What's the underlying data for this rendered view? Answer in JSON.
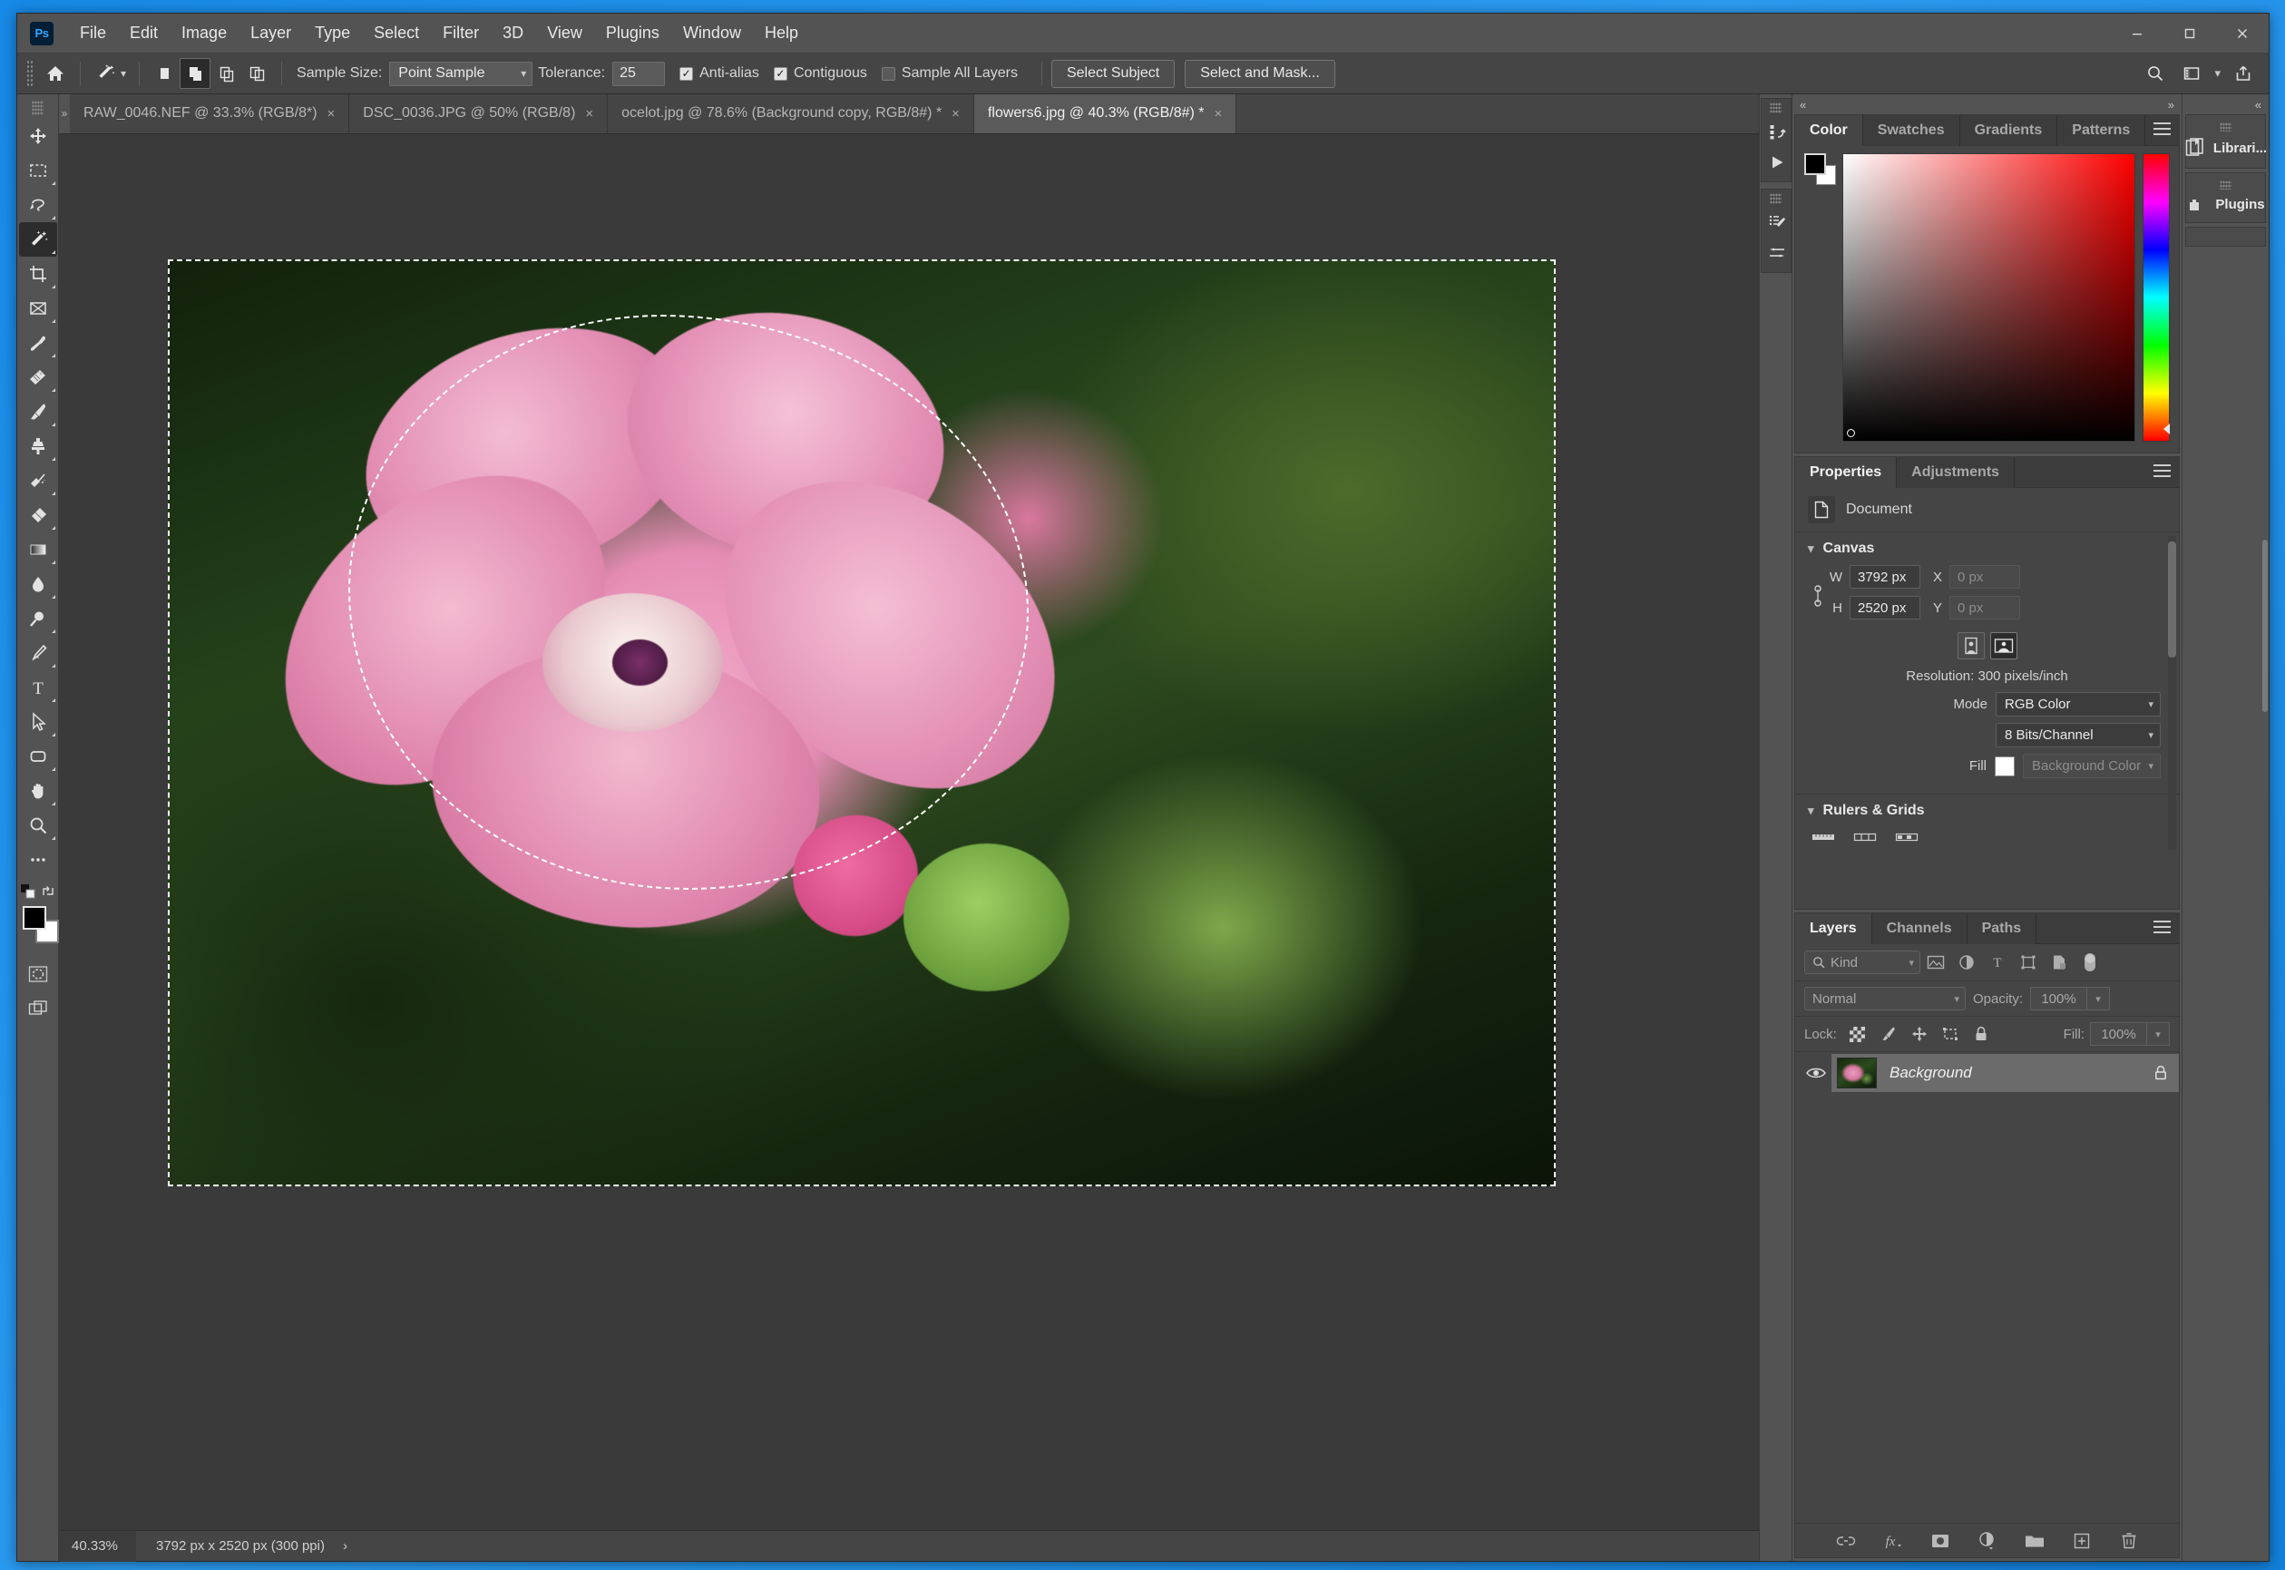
{
  "app": {
    "logo": "Ps",
    "menu": [
      "File",
      "Edit",
      "Image",
      "Layer",
      "Type",
      "Select",
      "Filter",
      "3D",
      "View",
      "Plugins",
      "Window",
      "Help"
    ],
    "window_controls": [
      "minimize-button",
      "maximize-button",
      "close-button"
    ]
  },
  "options_bar": {
    "home_icon": "home-icon",
    "tool_icon": "magic-wand-icon",
    "selection_modes": [
      "new-selection",
      "add-to-selection",
      "subtract-from-selection",
      "intersect-with-selection"
    ],
    "active_selection_mode": 1,
    "sample_size_label": "Sample Size:",
    "sample_size_value": "Point Sample",
    "tolerance_label": "Tolerance:",
    "tolerance_value": "25",
    "anti_alias_label": "Anti-alias",
    "anti_alias_checked": true,
    "contiguous_label": "Contiguous",
    "contiguous_checked": true,
    "sample_all_layers_label": "Sample All Layers",
    "sample_all_layers_checked": false,
    "select_subject_label": "Select Subject",
    "select_and_mask_label": "Select and Mask...",
    "right_icons": [
      "search-icon",
      "workspace-icon",
      "chevron-down-icon",
      "share-icon"
    ]
  },
  "tabs": [
    {
      "label": "RAW_0046.NEF @ 33.3% (RGB/8*)",
      "active": false
    },
    {
      "label": "DSC_0036.JPG @ 50% (RGB/8)",
      "active": false
    },
    {
      "label": "ocelot.jpg @ 78.6% (Background copy, RGB/8#) *",
      "active": false
    },
    {
      "label": "flowers6.jpg @ 40.3% (RGB/8#) *",
      "active": true
    }
  ],
  "toolbar": {
    "tools": [
      {
        "name": "move-tool",
        "active": false
      },
      {
        "name": "rectangular-marquee-tool",
        "active": false
      },
      {
        "name": "lasso-tool",
        "active": false
      },
      {
        "name": "magic-wand-tool",
        "active": true
      },
      {
        "name": "crop-tool",
        "active": false
      },
      {
        "name": "frame-tool",
        "active": false
      },
      {
        "name": "eyedropper-tool",
        "active": false
      },
      {
        "name": "spot-healing-brush-tool",
        "active": false
      },
      {
        "name": "brush-tool",
        "active": false
      },
      {
        "name": "clone-stamp-tool",
        "active": false
      },
      {
        "name": "history-brush-tool",
        "active": false
      },
      {
        "name": "eraser-tool",
        "active": false
      },
      {
        "name": "gradient-tool",
        "active": false
      },
      {
        "name": "blur-tool",
        "active": false
      },
      {
        "name": "dodge-tool",
        "active": false
      },
      {
        "name": "pen-tool",
        "active": false
      },
      {
        "name": "horizontal-type-tool",
        "active": false
      },
      {
        "name": "path-selection-tool",
        "active": false
      },
      {
        "name": "rectangle-tool",
        "active": false
      },
      {
        "name": "hand-tool",
        "active": false
      },
      {
        "name": "zoom-tool",
        "active": false
      },
      {
        "name": "edit-toolbar-tool",
        "active": false
      }
    ],
    "foreground_color": "#000000",
    "background_color": "#ffffff",
    "quick_mask_icon": "quick-mask-icon",
    "screen_mode_icon": "screen-mode-icon"
  },
  "status_bar": {
    "zoom": "40.33%",
    "doc_info": "3792 px x 2520 px (300 ppi)",
    "arrow": "›"
  },
  "rail_icons": [
    "history-icon",
    "play-icon",
    "brush-settings-icon",
    "brush-presets-icon"
  ],
  "color_panel": {
    "tabs": [
      "Color",
      "Swatches",
      "Gradients",
      "Patterns"
    ],
    "active_tab": "Color",
    "menu_icon": "panel-menu-icon",
    "foreground_color": "#000000",
    "background_color": "#ffffff"
  },
  "properties_panel": {
    "tabs": [
      "Properties",
      "Adjustments"
    ],
    "active_tab": "Properties",
    "menu_icon": "panel-menu-icon",
    "doc_row_label": "Document",
    "sections": {
      "canvas": {
        "title": "Canvas",
        "w_label": "W",
        "w_value": "3792 px",
        "h_label": "H",
        "h_value": "2520 px",
        "x_label": "X",
        "x_value": "0 px",
        "y_label": "Y",
        "y_value": "0 px",
        "orientation": [
          "portrait-orientation",
          "landscape-orientation"
        ],
        "active_orientation": 1,
        "resolution": "Resolution: 300 pixels/inch",
        "mode_label": "Mode",
        "mode_value": "RGB Color",
        "depth_value": "8 Bits/Channel",
        "fill_label": "Fill",
        "fill_value": "Background Color",
        "fill_color": "#ffffff"
      },
      "rulers_grids": {
        "title": "Rulers & Grids"
      }
    }
  },
  "layers_panel": {
    "tabs": [
      "Layers",
      "Channels",
      "Paths"
    ],
    "active_tab": "Layers",
    "menu_icon": "panel-menu-icon",
    "filter_kind": "Kind",
    "filter_icons": [
      "filter-pixel-icon",
      "filter-adjustment-icon",
      "filter-type-icon",
      "filter-shape-icon",
      "filter-smart-object-icon",
      "filter-toggle-icon"
    ],
    "blend_mode": "Normal",
    "opacity_label": "Opacity:",
    "opacity_value": "100%",
    "lock_label": "Lock:",
    "lock_icons": [
      "lock-transparency-icon",
      "lock-image-icon",
      "lock-position-icon",
      "lock-artboard-icon",
      "lock-all-icon"
    ],
    "fill_label": "Fill:",
    "fill_value": "100%",
    "layers": [
      {
        "name": "Background",
        "visible": true,
        "locked": true,
        "thumb": "flower-thumbnail"
      }
    ],
    "footer_icons": [
      "link-layers-icon",
      "layer-styles-icon",
      "layer-mask-icon",
      "adjustment-layer-icon",
      "new-group-icon",
      "new-layer-icon",
      "delete-layer-icon"
    ]
  },
  "far_dock": {
    "collapse_icon": "collapse-panels-icon",
    "items": [
      {
        "label": "Librari...",
        "icon": "libraries-icon"
      },
      {
        "label": "Plugins",
        "icon": "plugins-icon"
      }
    ]
  },
  "canvas": {
    "image_name": "flowers6.jpg",
    "selection": "marching-ants-selection"
  },
  "colors": {
    "accent": "#31a8ff",
    "panel_bg": "#454545",
    "chrome_bg": "#535353",
    "canvas_bg": "#3a3a3a",
    "desktop": "#1e8fe8"
  }
}
